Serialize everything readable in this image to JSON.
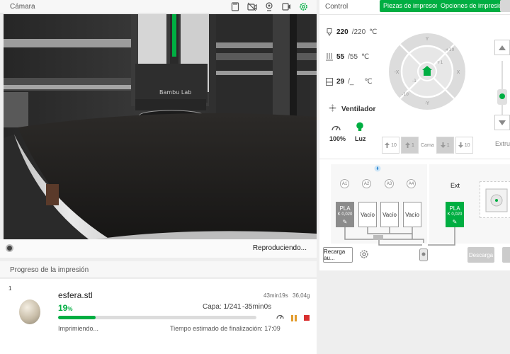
{
  "camera": {
    "title": "Cámara",
    "status": "Reproduciendo...",
    "toolbar_icons": [
      "sd-card-icon",
      "camera-off-icon",
      "webcam-icon",
      "timelapse-icon",
      "settings-icon"
    ],
    "nozzle_brand": "Bambu Lab"
  },
  "progress": {
    "title": "Progreso de la impresión",
    "plate_number": "1",
    "file_name": "esfera.stl",
    "time_estimate": "43min19s",
    "weight": "36,04g",
    "percent_value": "19",
    "percent_sign": "%",
    "fraction": 0.19,
    "layer": "Capa: 1/241",
    "remaining": "-35min0s",
    "state": "Imprimiendo...",
    "eta": "Tiempo estimado de finalización: 17:09"
  },
  "control": {
    "title": "Control",
    "parts_btn": "Piezas de impresora",
    "options_btn": "Opciones de impresión",
    "nozzle_temp": "220",
    "nozzle_target": "/220",
    "bed_temp": "55",
    "bed_target": "/55",
    "chamber_temp": "29",
    "chamber_target": "/_",
    "unit": "℃",
    "fan_label": "Ventilador",
    "fan_pct": "100%",
    "light_label": "Luz",
    "dpad": {
      "y_plus": "Y",
      "y_minus": "-Y",
      "x_plus": "X",
      "x_minus": "-X",
      "plus10": "+10",
      "plus1": "+1",
      "minus1": "-1",
      "minus10": "-10"
    },
    "step10": "10",
    "step1": "1",
    "bed_label": "Cama",
    "extruder_label": "Extrus"
  },
  "ams": {
    "slots": [
      {
        "id": "A1",
        "label": "PLA",
        "sub": "K 0,020",
        "color": "#8c8c8c"
      },
      {
        "id": "A2",
        "label": "Vacío",
        "sub": "",
        "color": "#ffffff"
      },
      {
        "id": "A3",
        "label": "Vacío",
        "sub": "",
        "color": "#ffffff"
      },
      {
        "id": "A4",
        "label": "Vacío",
        "sub": "",
        "color": "#ffffff"
      }
    ],
    "ext_title": "Ext",
    "ext_slot": {
      "label": "PLA",
      "sub": "K 0,020",
      "color": "#00ae42"
    },
    "reload_btn": "Recarga au...",
    "unload_btn": "Descarga"
  }
}
